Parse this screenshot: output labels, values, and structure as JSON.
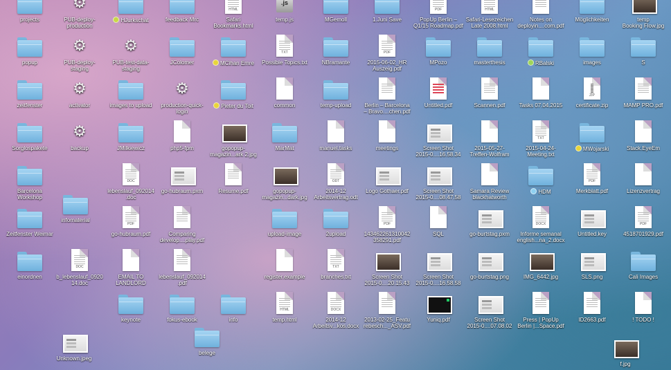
{
  "desktop": {
    "items": [
      {
        "label": "projects",
        "kind": "folder",
        "tag": ""
      },
      {
        "label": "PUB-deploy-\nproduction",
        "kind": "app",
        "tag": ""
      },
      {
        "label": "HJurkschat",
        "kind": "folder",
        "tag": "#c8d845"
      },
      {
        "label": "feedback Mrc",
        "kind": "folder",
        "tag": ""
      },
      {
        "label": "Safari\nBookmarks.html",
        "kind": "doc",
        "badge": "HTML",
        "tag": ""
      },
      {
        "label": "temp.js",
        "kind": "js",
        "tag": ""
      },
      {
        "label": "MGemoll",
        "kind": "folder",
        "tag": ""
      },
      {
        "label": "1.Juni Save",
        "kind": "folder",
        "tag": ""
      },
      {
        "label": "PopUp Berlin –\nQ1/15 Roadmap.pdf",
        "kind": "doc",
        "badge": "PDF",
        "tag": ""
      },
      {
        "label": "Safari-Lesezeichen\nLate 2008.html",
        "kind": "doc",
        "badge": "HTML",
        "tag": ""
      },
      {
        "label": "Notes on\ndeployin....com.pdf",
        "kind": "doc",
        "badge": "",
        "tag": ""
      },
      {
        "label": "Möglichkeiten",
        "kind": "folder",
        "tag": ""
      },
      {
        "label": "temp\nBooking Flow.jpg",
        "kind": "img",
        "tag": ""
      },
      {
        "label": "popup",
        "kind": "folder",
        "tag": ""
      },
      {
        "label": "PUB-deploy-\nstaging",
        "kind": "app",
        "tag": ""
      },
      {
        "label": "PUB-test-data-\nstaging",
        "kind": "app",
        "tag": ""
      },
      {
        "label": "JColomer",
        "kind": "folder",
        "tag": ""
      },
      {
        "label": "MCihan Emre",
        "kind": "folder",
        "tag": "#e8d53a"
      },
      {
        "label": "Possible Topics.txt",
        "kind": "doc",
        "badge": "TXT",
        "tag": ""
      },
      {
        "label": "NBramante",
        "kind": "folder",
        "tag": ""
      },
      {
        "label": "2015-06-02_HR\nAuszeig.pdf",
        "kind": "doc",
        "badge": "PDF",
        "tag": ""
      },
      {
        "label": "MPozo",
        "kind": "folder",
        "tag": ""
      },
      {
        "label": "masterthesis",
        "kind": "folder",
        "tag": ""
      },
      {
        "label": "RBalski",
        "kind": "folder",
        "tag": "#9fd55a"
      },
      {
        "label": "images",
        "kind": "folder",
        "tag": ""
      },
      {
        "label": "S",
        "kind": "folder",
        "tag": ""
      },
      {
        "label": "zeitfenster",
        "kind": "folder",
        "tag": ""
      },
      {
        "label": "activator",
        "kind": "app",
        "tag": ""
      },
      {
        "label": "images to upload",
        "kind": "folder",
        "tag": ""
      },
      {
        "label": "production-quick-\nlogin",
        "kind": "app",
        "tag": ""
      },
      {
        "label": "Pieter du Toit",
        "kind": "folder",
        "tag": "#e8d53a"
      },
      {
        "label": "common",
        "kind": "blank",
        "tag": ""
      },
      {
        "label": "temp-upload",
        "kind": "folder",
        "tag": ""
      },
      {
        "label": "Berlin – Barcelona\n– Bravo....chen.pdf",
        "kind": "doc",
        "badge": "",
        "tag": ""
      },
      {
        "label": "Untitled.pdf",
        "kind": "red",
        "tag": ""
      },
      {
        "label": "Scannen.pdf",
        "kind": "doc",
        "badge": "",
        "tag": ""
      },
      {
        "label": "Tasks 07.04.2015",
        "kind": "blank",
        "tag": ""
      },
      {
        "label": "certificate.zip",
        "kind": "zip",
        "badge": "ZIP",
        "tag": ""
      },
      {
        "label": "MAMP PRO.pdf",
        "kind": "doc",
        "badge": "",
        "tag": ""
      },
      {
        "label": "Sorglospakete",
        "kind": "folder",
        "tag": ""
      },
      {
        "label": "backup",
        "kind": "app",
        "tag": ""
      },
      {
        "label": "JMilkiewicz",
        "kind": "folder",
        "tag": ""
      },
      {
        "label": "php5-fpm",
        "kind": "blank",
        "tag": ""
      },
      {
        "label": "gopopup-\nmagazin...ark 2.jpg",
        "kind": "img",
        "tag": ""
      },
      {
        "label": "MarMat",
        "kind": "folder",
        "tag": ""
      },
      {
        "label": "manuel.tasks",
        "kind": "blank",
        "tag": ""
      },
      {
        "label": "meetings",
        "kind": "blank",
        "tag": ""
      },
      {
        "label": "Screen Shot\n2015-0....16.58.34",
        "kind": "shot",
        "tag": ""
      },
      {
        "label": "2015-05-27-\nTreffen-Wolfram",
        "kind": "blank",
        "tag": ""
      },
      {
        "label": "2015-04-24-\nMeeting.txt",
        "kind": "doc",
        "badge": "TXT",
        "tag": ""
      },
      {
        "label": "MWojarski",
        "kind": "folder",
        "tag": "#e8d53a"
      },
      {
        "label": "Stack.EyeEm",
        "kind": "blank",
        "tag": ""
      },
      {
        "label": "Barcelona\nWorkshop",
        "kind": "folder",
        "tag": ""
      },
      {
        "label": "lebenslauf_092014\n.doc",
        "kind": "doc",
        "badge": "DOC",
        "tag": ""
      },
      {
        "label": "go-hubraum.pxm",
        "kind": "shot",
        "tag": ""
      },
      {
        "label": "Resume.pdf",
        "kind": "doc",
        "badge": "",
        "tag": ""
      },
      {
        "label": "gopopup-\nmagazin...dark.jpg",
        "kind": "img",
        "tag": ""
      },
      {
        "label": "2014-12\nArbeitsvertrag.odt",
        "kind": "doc",
        "badge": "ODT",
        "tag": ""
      },
      {
        "label": "Logo Gothaer.pdf",
        "kind": "shot",
        "tag": ""
      },
      {
        "label": "Screen Shot\n2015-0....08.47.58",
        "kind": "shot",
        "tag": ""
      },
      {
        "label": "Samara Review\nblackhatworth",
        "kind": "blank",
        "tag": ""
      },
      {
        "label": "HDM",
        "kind": "folder",
        "tag": "#8fd0f0"
      },
      {
        "label": "Merkblatt.pdf",
        "kind": "doc",
        "badge": "PDF",
        "tag": ""
      },
      {
        "label": "Lizenzvertrag",
        "kind": "blank",
        "tag": ""
      },
      {
        "label": "infomaterial",
        "kind": "folder",
        "tag": ""
      },
      {
        "label": "Zeitfenster Weimar",
        "kind": "folder",
        "tag": ""
      },
      {
        "label": "go-hubraum.pdf",
        "kind": "doc",
        "badge": "PDF",
        "tag": ""
      },
      {
        "label": "Comparing\ndevelop....play.pdf",
        "kind": "doc",
        "badge": "",
        "tag": ""
      },
      {
        "label": "upload-image",
        "kind": "folder",
        "tag": ""
      },
      {
        "label": "2upload",
        "kind": "folder",
        "tag": ""
      },
      {
        "label": "143462261310042\n358291.pdf",
        "kind": "doc",
        "badge": "PDF",
        "tag": ""
      },
      {
        "label": "SQL",
        "kind": "blank",
        "tag": ""
      },
      {
        "label": "go-burtstag.pxm",
        "kind": "shot",
        "tag": ""
      },
      {
        "label": "Informe semanal\nenglish...na_2.docx",
        "kind": "doc",
        "badge": "DOCX",
        "tag": ""
      },
      {
        "label": "Untitled.key",
        "kind": "shot",
        "tag": ""
      },
      {
        "label": "4518701929.pdf",
        "kind": "doc",
        "badge": "PDF",
        "tag": ""
      },
      {
        "label": "einordnen",
        "kind": "folder",
        "tag": ""
      },
      {
        "label": "b_lebenslauf_0920\n14.doc",
        "kind": "doc",
        "badge": "DOC",
        "tag": ""
      },
      {
        "label": "EMAIL TO\nLANDLORD",
        "kind": "blank",
        "tag": ""
      },
      {
        "label": "lebenslauf_092014\n.pdf",
        "kind": "doc",
        "badge": "",
        "tag": ""
      },
      {
        "label": "register.example",
        "kind": "blank",
        "tag": ""
      },
      {
        "label": "branches.txt",
        "kind": "doc",
        "badge": "TXT",
        "tag": ""
      },
      {
        "label": "Screen Shot\n2015-0....20.15.43",
        "kind": "img",
        "tag": ""
      },
      {
        "label": "Screen Shot\n2015-0....16.58.58",
        "kind": "shot",
        "tag": ""
      },
      {
        "label": "go-burtstag.png",
        "kind": "shot",
        "tag": ""
      },
      {
        "label": "IMG_6442.jpg",
        "kind": "img",
        "tag": ""
      },
      {
        "label": "SLS.png",
        "kind": "shot",
        "tag": ""
      },
      {
        "label": "Cali Images",
        "kind": "folder",
        "tag": ""
      },
      {
        "label": "keynote",
        "kind": "folder",
        "tag": ""
      },
      {
        "label": "fokus-ebook",
        "kind": "folder",
        "tag": ""
      },
      {
        "label": "info",
        "kind": "folder",
        "tag": ""
      },
      {
        "label": "temp.html",
        "kind": "doc",
        "badge": "HTML",
        "tag": ""
      },
      {
        "label": "2014-12\nArbeitsv...kos.docx",
        "kind": "doc",
        "badge": "DOCX",
        "tag": ""
      },
      {
        "label": "2013-02-25_Featu\nrebesch..._ASV.pdf",
        "kind": "doc",
        "badge": "",
        "tag": ""
      },
      {
        "label": "Yuniq.pdf",
        "kind": "dark",
        "tag": ""
      },
      {
        "label": "Screen Shot\n2015-0....07.08.02",
        "kind": "shot",
        "tag": ""
      },
      {
        "label": "Press | PopUp\nBerlin |...Space.pdf",
        "kind": "doc",
        "badge": "",
        "tag": ""
      },
      {
        "label": "ID2663.pdf",
        "kind": "doc",
        "badge": "",
        "tag": ""
      },
      {
        "label": "! TODO !",
        "kind": "blank",
        "tag": ""
      },
      {
        "label": "belege",
        "kind": "folder",
        "tag": ""
      },
      {
        "label": "Unknown.jpeg",
        "kind": "shot",
        "tag": ""
      },
      {
        "label": "f.jpg",
        "kind": "img",
        "tag": ""
      }
    ]
  }
}
